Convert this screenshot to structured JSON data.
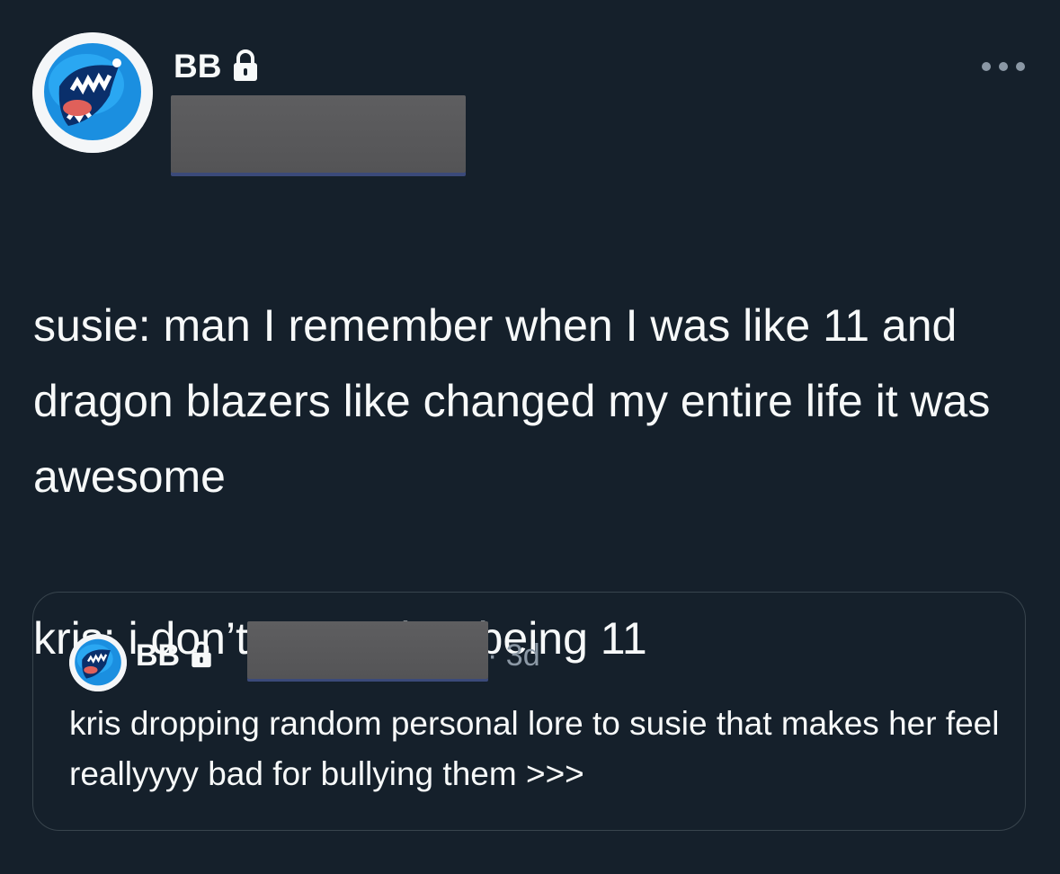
{
  "tweet": {
    "author": {
      "name": "BB",
      "avatar_icon": "blue-monster-avatar",
      "protected_icon": "lock-icon",
      "handle_redacted": true
    },
    "more_icon": "more-horizontal-icon",
    "text_paragraphs": [
      "susie: man I remember when I was like 11 and dragon blazers like changed my entire life it was awesome",
      "kris: i don’t remember being 11"
    ],
    "quoted_tweet": {
      "author_name": "BB",
      "handle_redacted": true,
      "separator": "·",
      "time": "3d",
      "text": "kris dropping random personal lore to susie that makes her feel reallyyyy bad for bullying them >>>"
    }
  },
  "colors": {
    "background": "#15202b",
    "text_primary": "#f7f9f9",
    "text_secondary": "#8b98a5",
    "border": "#38444d",
    "redaction": "#59595b"
  }
}
